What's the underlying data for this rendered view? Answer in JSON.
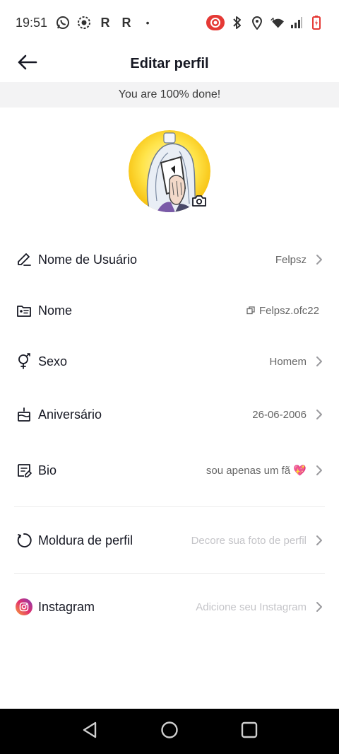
{
  "status_bar": {
    "time": "19:51",
    "left_icons": [
      "whatsapp-icon",
      "record-icon"
    ],
    "letters": [
      "R",
      "R"
    ],
    "dot": "•",
    "right_icons": [
      "screen-record-icon",
      "bluetooth-icon",
      "location-icon",
      "wifi-icon",
      "signal-icon",
      "battery-icon"
    ]
  },
  "header": {
    "title": "Editar perfil",
    "back_icon": "arrow-left-icon"
  },
  "progress": {
    "text": "You are 100% done!"
  },
  "avatar": {
    "icon": "camera-icon"
  },
  "rows": [
    {
      "label": "Nome de Usuário",
      "value": "Felpsz",
      "icon": "pencil-icon"
    },
    {
      "label": "Nome",
      "value": "Felpsz.ofc22",
      "icon": "id-card-icon"
    },
    {
      "label": "Sexo",
      "value": "Homem",
      "icon": "gender-icon"
    },
    {
      "label": "Aniversário",
      "value": "26-06-2006",
      "icon": "cake-icon"
    },
    {
      "label": "Bio",
      "value": "sou apenas um fã 💖",
      "icon": "note-icon"
    },
    {
      "label": "Moldura de perfil",
      "value": "Decore sua foto de perfil",
      "icon": "refresh-icon"
    },
    {
      "label": "Instagram",
      "value": "Adicione seu Instagram",
      "icon": "instagram-icon"
    }
  ],
  "colors": {
    "accent": "#e53935",
    "title": "#161823",
    "secondary_text": "#666666",
    "placeholder_text": "#c4c4c8",
    "strip_bg": "#f3f3f4",
    "instagram_gradient": [
      "#f9a33a",
      "#e1306c",
      "#833ab4"
    ]
  },
  "nav_bar": {
    "buttons": [
      "back-triangle-icon",
      "home-circle-icon",
      "recents-square-icon"
    ]
  }
}
